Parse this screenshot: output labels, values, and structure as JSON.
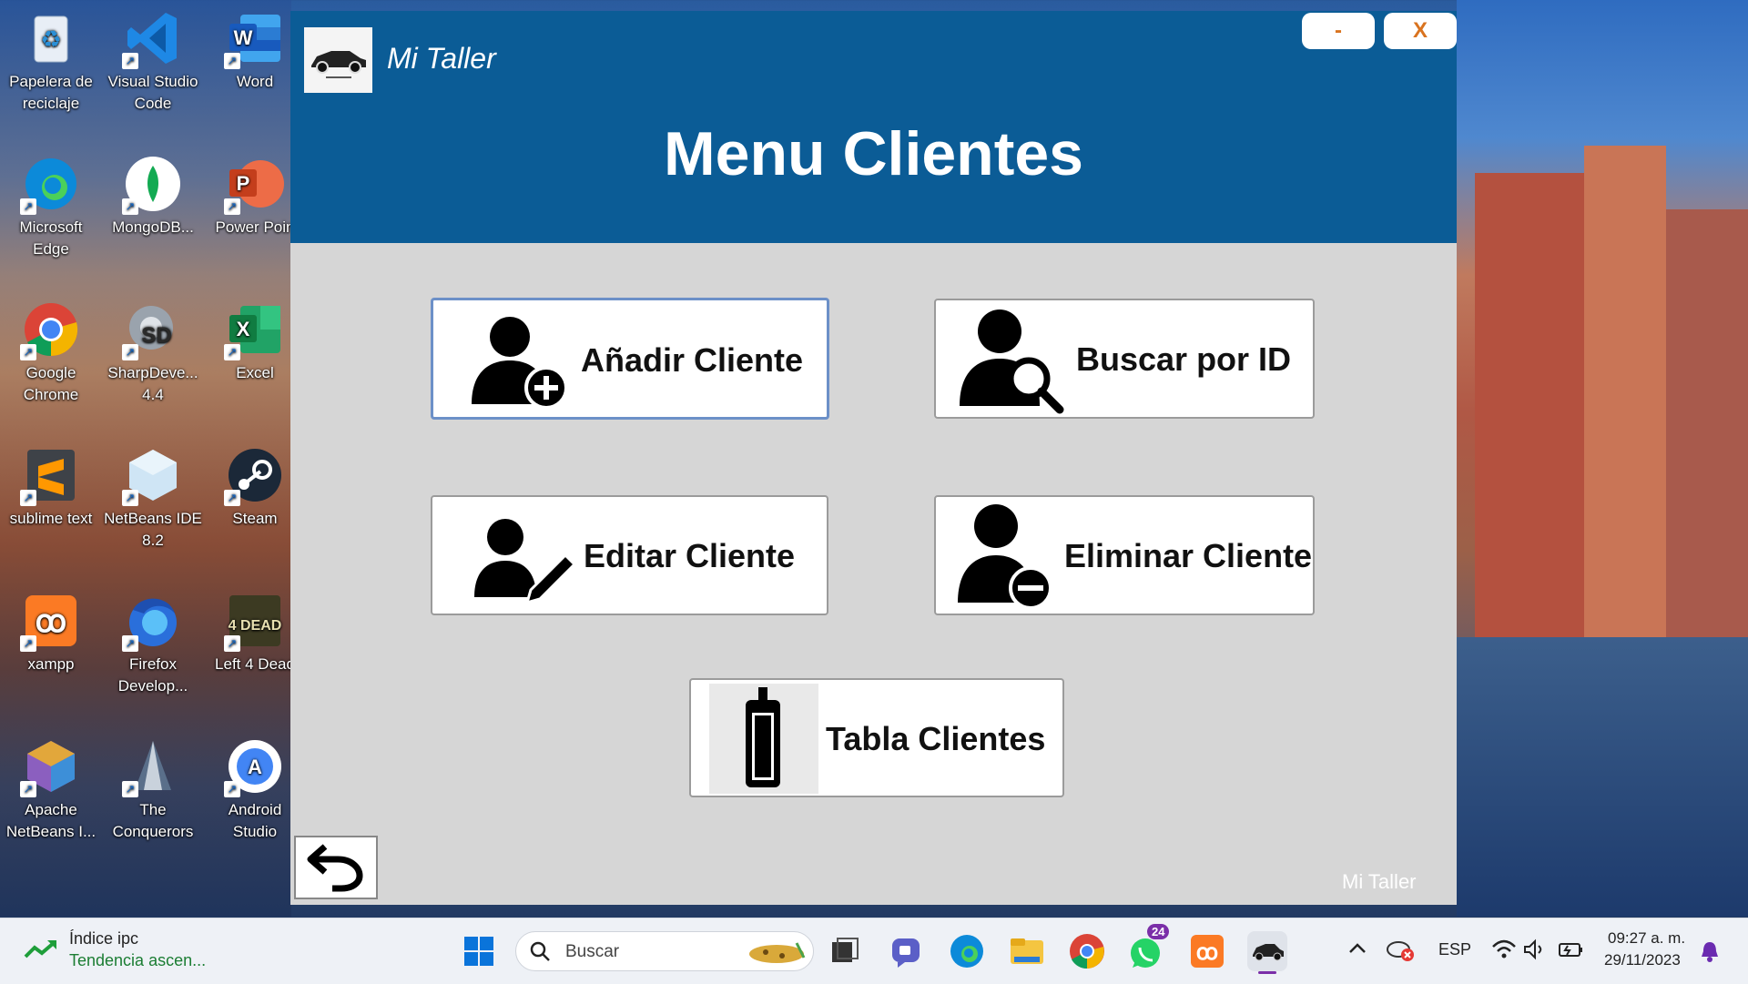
{
  "desktop_icons": [
    {
      "name": "recycle-bin-icon",
      "label": "Papelera de reciclaje"
    },
    {
      "name": "vscode-icon",
      "label": "Visual Studio Code"
    },
    {
      "name": "word-icon",
      "label": "Word"
    },
    {
      "name": "edge-icon",
      "label": "Microsoft Edge"
    },
    {
      "name": "mongodb-icon",
      "label": "MongoDB..."
    },
    {
      "name": "powerpoint-icon",
      "label": "Power Poin"
    },
    {
      "name": "chrome-icon",
      "label": "Google Chrome"
    },
    {
      "name": "sharpdevelop-icon",
      "label": "SharpDeve... 4.4"
    },
    {
      "name": "excel-icon",
      "label": "Excel"
    },
    {
      "name": "sublime-text-icon",
      "label": "sublime text"
    },
    {
      "name": "netbeans-icon",
      "label": "NetBeans IDE 8.2"
    },
    {
      "name": "steam-icon",
      "label": "Steam"
    },
    {
      "name": "xampp-icon",
      "label": "xampp"
    },
    {
      "name": "firefox-dev-icon",
      "label": "Firefox Develop..."
    },
    {
      "name": "left4dead-icon",
      "label": "Left 4 Dead"
    },
    {
      "name": "apache-netbeans-icon",
      "label": "Apache NetBeans I..."
    },
    {
      "name": "the-conquerors-icon",
      "label": "The Conquerors"
    },
    {
      "name": "android-studio-icon",
      "label": "Android Studio"
    }
  ],
  "app": {
    "title": "Mi Taller",
    "minimize_label": "-",
    "close_label": "X",
    "menu_title": "Menu Clientes",
    "buttons": {
      "add": "Añadir Cliente",
      "search": "Buscar por ID",
      "edit": "Editar Cliente",
      "delete": "Eliminar Cliente",
      "table": "Tabla Clientes"
    },
    "footer": "Mi Taller",
    "colors": {
      "header": "#0b5c96",
      "body": "#d6d6d6"
    }
  },
  "taskbar": {
    "widget_title": "Índice ipc",
    "widget_subtitle": "Tendencia ascen...",
    "search_placeholder": "Buscar",
    "whatsapp_badge": "24",
    "language": "ESP",
    "time": "09:27 a. m.",
    "date": "29/11/2023"
  }
}
